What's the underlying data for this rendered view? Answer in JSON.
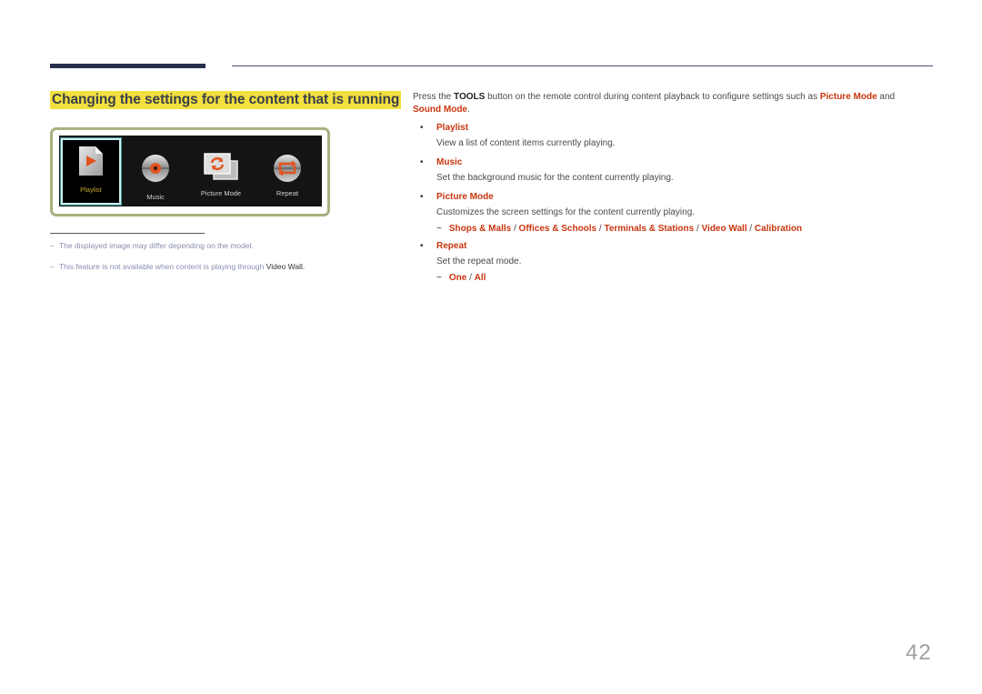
{
  "header": {
    "section_title": "Changing the settings for the content that is running"
  },
  "screen_menu": {
    "items": [
      {
        "label": "Playlist",
        "icon": "playlist-file-play-icon",
        "selected": true
      },
      {
        "label": "Music",
        "icon": "music-disc-icon",
        "selected": false
      },
      {
        "label": "Picture Mode",
        "icon": "picture-mode-icon",
        "selected": false
      },
      {
        "label": "Repeat",
        "icon": "repeat-icon",
        "selected": false
      }
    ]
  },
  "footnotes": [
    {
      "text": "The displayed image may differ depending on the model."
    },
    {
      "text": "This feature is not available when content is playing through ",
      "emphasis": "Video Wall",
      "end": "."
    }
  ],
  "intro": {
    "part1": "Press the ",
    "tools": "TOOLS",
    "part2": " button on the remote control during content playback to configure settings such as ",
    "picture_mode": "Picture Mode",
    "part3": " and",
    "sound_mode": "Sound Mode",
    "part4": "."
  },
  "items": [
    {
      "title": "Playlist",
      "desc": "View a list of content items currently playing."
    },
    {
      "title": "Music",
      "desc": "Set the background music for the content currently playing."
    },
    {
      "title": "Picture Mode",
      "desc": "Customizes the screen settings for the content currently playing.",
      "options": [
        "Shops & Malls",
        "Offices & Schools",
        "Terminals & Stations",
        "Video Wall",
        "Calibration"
      ]
    },
    {
      "title": "Repeat",
      "desc": "Set the repeat mode.",
      "options": [
        "One",
        "All"
      ]
    }
  ],
  "separator": " / ",
  "dash": "−",
  "bullet": "•",
  "page_number": "42",
  "colors": {
    "accent": "#c8350e",
    "title_highlight": "#f2e03e",
    "frame_border": "#a6b37e",
    "top_bar": "#262f4d"
  }
}
